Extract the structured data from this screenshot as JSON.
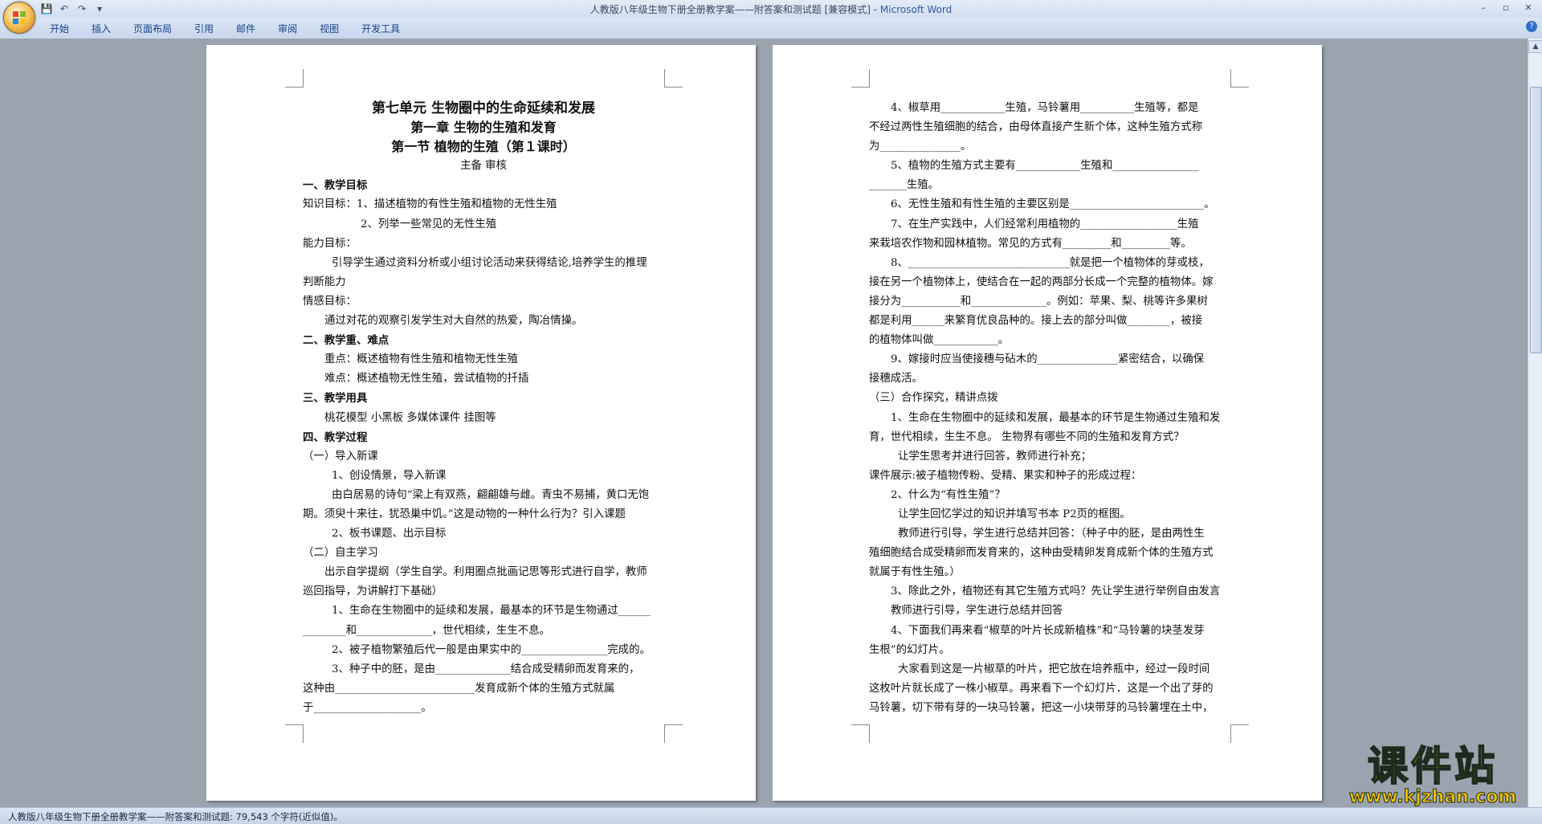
{
  "window": {
    "title": "人教版八年级生物下册全册教学案——附答案和测试题 [兼容模式] - ",
    "app_name": "Microsoft Word",
    "controls": [
      "–",
      "▫",
      "✕"
    ]
  },
  "quick_access": {
    "save": "💾",
    "undo": "↶",
    "redo": "↷",
    "more": "▾"
  },
  "ribbon": {
    "tabs": [
      "开始",
      "插入",
      "页面布局",
      "引用",
      "邮件",
      "审阅",
      "视图",
      "开发工具"
    ],
    "help": "?"
  },
  "page1": {
    "lines": [
      {
        "t": "第七单元  生物圈中的生命延续和发展",
        "s": "c b h1"
      },
      {
        "t": "第一章  生物的生殖和发育",
        "s": "c b h2"
      },
      {
        "t": "    第一节   植物的生殖（第１课时）",
        "s": "c b h2"
      },
      {
        "t": "主备      审核",
        "s": "c"
      },
      {
        "t": "一、教学目标",
        "s": "b"
      },
      {
        "t": "知识目标：1、描述植物的有性生殖和植物的无性生殖",
        "s": ""
      },
      {
        "t": "2、列举一些常见的无性生殖",
        "s": "ind3"
      },
      {
        "t": "能力目标：",
        "s": ""
      },
      {
        "t": "引导学生通过资料分析或小组讨论活动来获得结论,培养学生的推理",
        "s": "ind2"
      },
      {
        "t": "判断能力",
        "s": ""
      },
      {
        "t": "情感目标：",
        "s": ""
      },
      {
        "t": "通过对花的观察引发学生对大自然的热爱，陶冶情操。",
        "s": "ind1"
      },
      {
        "t": "二、教学重、难点",
        "s": "b"
      },
      {
        "t": "重点：概述植物有性生殖和植物无性生殖",
        "s": "ind1"
      },
      {
        "t": "难点：概述植物无性生殖，尝试植物的扦插",
        "s": "ind1"
      },
      {
        "t": "三、教学用具",
        "s": "b"
      },
      {
        "t": "桃花模型    小黑板    多媒体课件     挂图等",
        "s": "ind1"
      },
      {
        "t": "四、教学过程",
        "s": "b"
      },
      {
        "t": "（一）导入新课",
        "s": ""
      },
      {
        "t": "1、创设情景，导入新课",
        "s": "ind2"
      },
      {
        "t": "由白居易的诗句“梁上有双燕，翩翩雄与雌。青虫不易捕，黄口无饱",
        "s": "ind2"
      },
      {
        "t": "期。须臾十来往，犹恐巢中饥。”这是动物的一种什么行为？引入课题",
        "s": ""
      },
      {
        "t": "2、板书课题、出示目标",
        "s": "ind2"
      },
      {
        "t": "（二）自主学习",
        "s": ""
      },
      {
        "t": "出示自学提纲（学生自学。利用圈点批画记思等形式进行自学，教师",
        "s": "ind1"
      },
      {
        "t": "巡回指导，为讲解打下基础）",
        "s": ""
      },
      {
        "t": "1、生命在生物圈中的延续和发展，最基本的环节是生物通过______",
        "s": "ind2"
      },
      {
        "t": "________和______________，世代相续，生生不息。",
        "s": ""
      },
      {
        "t": "2、被子植物繁殖后代一般是由果实中的________________完成的。",
        "s": "ind2"
      },
      {
        "t": "3、种子中的胚，是由______________结合成受精卵而发育来的，",
        "s": "ind2"
      },
      {
        "t": "这种由__________________________发育成新个体的生殖方式就属",
        "s": ""
      },
      {
        "t": "于____________________。",
        "s": ""
      }
    ]
  },
  "page2": {
    "lines": [
      {
        "t": "4、椒草用____________生殖，马铃薯用__________生殖等，都是",
        "s": "ind1"
      },
      {
        "t": "不经过两性生殖细胞的结合，由母体直接产生新个体，这种生殖方式称",
        "s": ""
      },
      {
        "t": "为_______________。",
        "s": ""
      },
      {
        "t": "5、植物的生殖方式主要有____________生殖和________________",
        "s": "ind1"
      },
      {
        "t": "_______生殖。",
        "s": ""
      },
      {
        "t": "6、无性生殖和有性生殖的主要区别是_________________________。",
        "s": "ind1"
      },
      {
        "t": "7、在生产实践中，人们经常利用植物的__________________生殖",
        "s": "ind1"
      },
      {
        "t": "来栽培农作物和园林植物。常见的方式有_________和_________等。",
        "s": ""
      },
      {
        "t": "8、______________________________就是把一个植物体的芽或枝，",
        "s": "ind1"
      },
      {
        "t": "接在另一个植物体上，使结合在一起的两部分长成一个完整的植物体。嫁",
        "s": ""
      },
      {
        "t": "接分为___________和______________。例如：苹果、梨、桃等许多果树",
        "s": ""
      },
      {
        "t": "都是利用______来繁育优良品种的。接上去的部分叫做________，被接",
        "s": ""
      },
      {
        "t": "的植物体叫做____________。",
        "s": ""
      },
      {
        "t": "9、嫁接时应当使接穗与砧木的_______________紧密结合，以确保",
        "s": "ind1"
      },
      {
        "t": "接穗成活。",
        "s": ""
      },
      {
        "t": "（三）合作探究，精讲点拨",
        "s": ""
      },
      {
        "t": "1、生命在生物圈中的延续和发展，最基本的环节是生物通过生殖和发",
        "s": "ind1"
      },
      {
        "t": "育，世代相续，生生不息。 生物界有哪些不同的生殖和发育方式？",
        "s": ""
      },
      {
        "t": "让学生思考并进行回答，教师进行补充；",
        "s": "ind2"
      },
      {
        "t": "课件展示:被子植物传粉、受精、果实和种子的形成过程：",
        "s": ""
      },
      {
        "t": "2、什么为“有性生殖”？",
        "s": "ind1"
      },
      {
        "t": "让学生回忆学过的知识并填写书本 P2页的框图。",
        "s": "ind2"
      },
      {
        "t": "教师进行引导，学生进行总结并回答：（种子中的胚，是由两性生",
        "s": "ind2"
      },
      {
        "t": "殖细胞结合成受精卵而发育来的，这种由受精卵发育成新个体的生殖方式",
        "s": ""
      },
      {
        "t": "就属于有性生殖。）",
        "s": ""
      },
      {
        "t": "3、除此之外，植物还有其它生殖方式吗？先让学生进行举例自由发言",
        "s": "ind1"
      },
      {
        "t": "教师进行引导，学生进行总结并回答",
        "s": "ind1"
      },
      {
        "t": "4、下面我们再来看“椒草的叶片长成新植株”和“马铃薯的块茎发芽",
        "s": "ind1"
      },
      {
        "t": "生根”的幻灯片。",
        "s": ""
      },
      {
        "t": "大家看到这是一片椒草的叶片，把它放在培养瓶中，经过一段时间",
        "s": "ind2"
      },
      {
        "t": "这枚叶片就长成了一株小椒草。再来看下一个幻灯片．这是一个出了芽的",
        "s": ""
      },
      {
        "t": "马铃薯，切下带有芽的一块马铃薯，把这一小块带芽的马铃薯埋在土中，",
        "s": ""
      }
    ]
  },
  "status": {
    "text": "人教版八年级生物下册全册教学案——附答案和测试题: 79,543 个字符(近似值)。"
  },
  "watermark": {
    "text": "课件站",
    "url": "www.kjzhan.com"
  }
}
